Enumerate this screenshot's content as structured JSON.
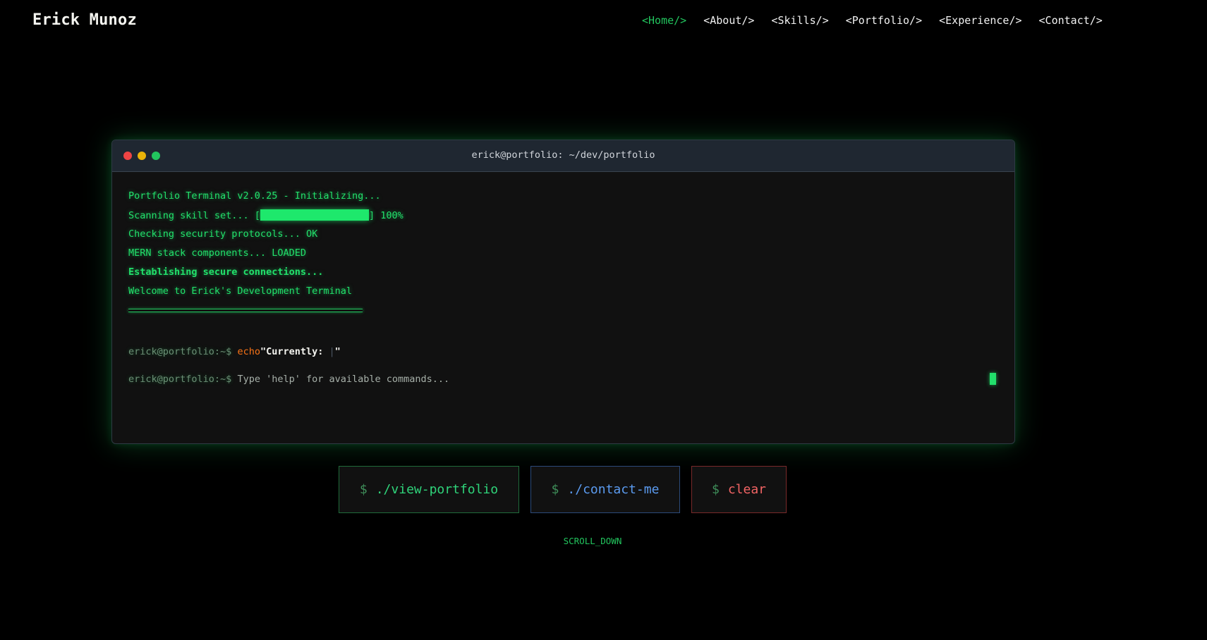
{
  "header": {
    "brand": "Erick Munoz",
    "nav": [
      {
        "label": "<Home/>",
        "active": true
      },
      {
        "label": "<About/>"
      },
      {
        "label": "<Skills/>"
      },
      {
        "label": "<Portfolio/>"
      },
      {
        "label": "<Experience/>"
      },
      {
        "label": "<Contact/>"
      }
    ]
  },
  "terminal": {
    "title": "erick@portfolio: ~/dev/portfolio",
    "lines": {
      "init": "Portfolio Terminal v2.0.25 - Initializing...",
      "scan_prefix": "Scanning skill set... [",
      "scan_suffix": "] 100%",
      "scan_progress": 100,
      "security": "Checking security protocols... OK",
      "mern": "MERN stack components... LOADED",
      "connections": "Establishing secure connections...",
      "welcome": "Welcome to Erick's Development Terminal"
    },
    "prompt": "erick@portfolio:~$ ",
    "echo_cmd": "echo",
    "echo_string_open": "\"Currently: ",
    "echo_caret": "|",
    "echo_string_close": "\"",
    "input_placeholder": "Type 'help' for available commands..."
  },
  "buttons": {
    "dollar": "$",
    "view_portfolio": "./view-portfolio",
    "contact_me": "./contact-me",
    "clear": "clear"
  },
  "scroll_label": "SCROLL_DOWN",
  "colors": {
    "accent_green": "#22c55e",
    "terminal_text": "#22e06b",
    "command_orange": "#f97316",
    "contact_blue": "#5b9bf0",
    "clear_red": "#f26464"
  }
}
